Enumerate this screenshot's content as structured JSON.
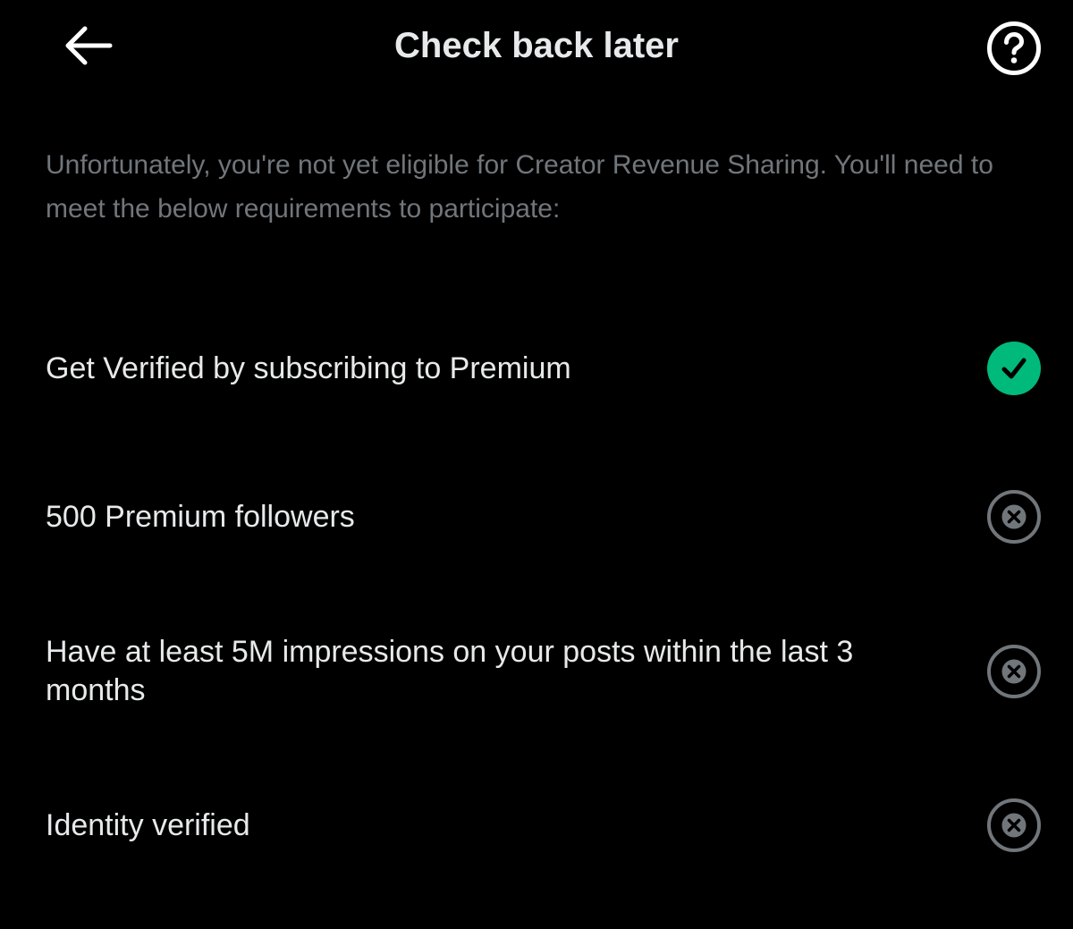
{
  "header": {
    "title": "Check back later",
    "back_icon": "arrow-left-icon",
    "help_icon": "question-circle-icon"
  },
  "intro": {
    "text": "Unfortunately, you're not yet eligible for Creator Revenue Sharing. You'll need to meet the below requirements to participate:"
  },
  "requirements": [
    {
      "label": "Get Verified by subscribing to Premium",
      "met": true,
      "icon": "check-circle-icon"
    },
    {
      "label": "500 Premium followers",
      "met": false,
      "icon": "x-circle-icon"
    },
    {
      "label": "Have at least 5M impressions on your posts within the last 3 months",
      "met": false,
      "icon": "x-circle-icon"
    },
    {
      "label": "Identity verified",
      "met": false,
      "icon": "x-circle-icon"
    }
  ],
  "colors": {
    "background": "#000000",
    "text_primary": "#e7e9ea",
    "text_secondary": "#71767b",
    "success": "#00ba7c",
    "unmet": "#71767b"
  }
}
